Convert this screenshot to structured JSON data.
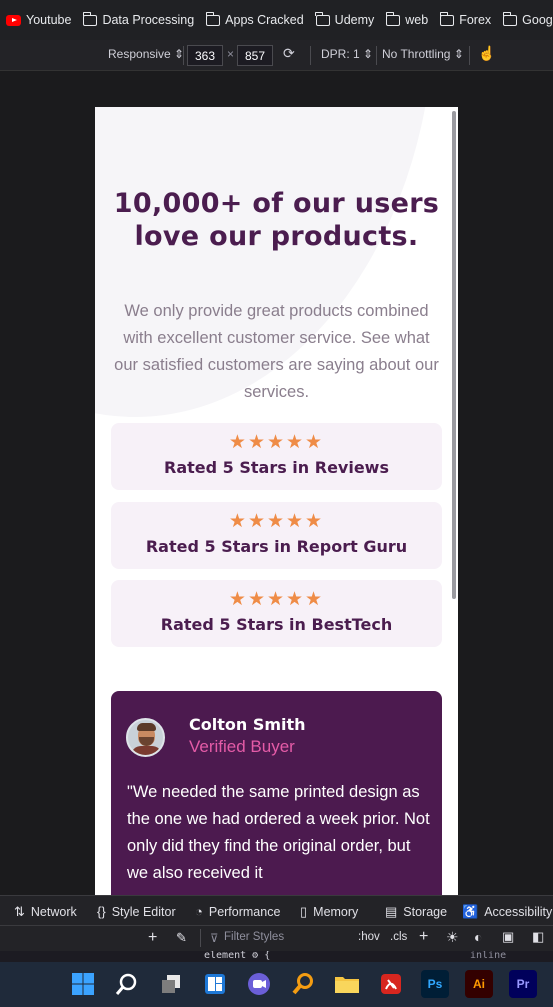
{
  "bookmarks": [
    "Youtube",
    "Data Processing",
    "Apps Cracked",
    "Udemy",
    "web",
    "Forex",
    "Google D"
  ],
  "responsive_toolbar": {
    "mode": "Responsive",
    "width": "363",
    "times": "×",
    "height": "857",
    "dpr": "DPR: 1",
    "throttling": "No Throttling"
  },
  "page": {
    "headline": "10,000+ of our users love our products.",
    "subtext": "We only provide great products combined with excellent customer service. See what our satisfied customers are saying about our services.",
    "ratings": [
      {
        "stars": "★★★★★",
        "label": "Rated 5 Stars in Reviews"
      },
      {
        "stars": "★★★★★",
        "label": "Rated 5 Stars in Report Guru"
      },
      {
        "stars": "★★★★★",
        "label": "Rated 5 Stars in BestTech"
      }
    ],
    "testimonial": {
      "name": "Colton Smith",
      "role": "Verified Buyer",
      "quote": "\"We needed the same printed design as the one we had ordered a week prior. Not only did they find the original order, but we also received it"
    }
  },
  "devtools": {
    "tabs": [
      "Network",
      "Style Editor",
      "Performance",
      "Memory",
      "Storage",
      "Accessibility"
    ],
    "filter_placeholder": "Filter Styles",
    "hov": ":hov",
    "cls": ".cls",
    "element_line": "element ⚙ {",
    "inline": "inline"
  },
  "colors": {
    "headline": "#4b1d4f",
    "star": "#ef8c47",
    "card_bg": "#f7f1f8",
    "testimonial_bg": "#4c1a4f",
    "role": "#e45ba7"
  }
}
